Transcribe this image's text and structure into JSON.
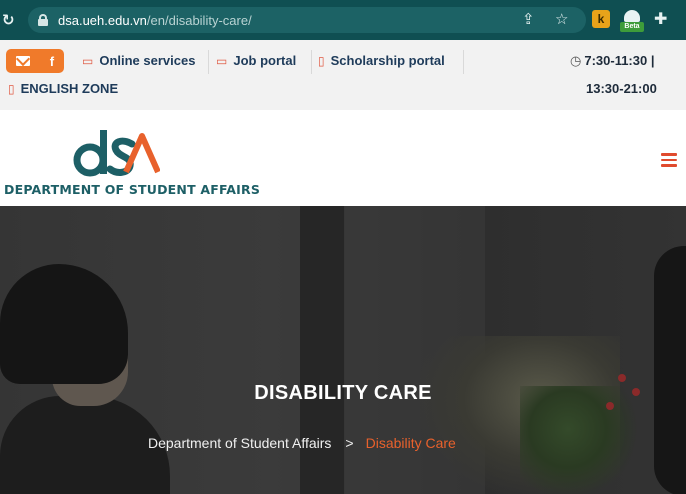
{
  "browser": {
    "url_host": "dsa.ueh.edu.vn",
    "url_path": "/en/disability-care/",
    "ext_k_label": "k",
    "ext_beta_label": "Beta"
  },
  "topbar": {
    "social": [
      "mail",
      "f"
    ],
    "links": {
      "online": "Online services",
      "job": "Job portal",
      "scholarship": "Scholarship portal",
      "english": "ENGLISH ZONE"
    },
    "hours_line1": "7:30-11:30 |",
    "hours_line2": "13:30-21:00"
  },
  "header": {
    "department_name": "DEPARTMENT OF STUDENT AFFAIRS",
    "logo_alt": "dSA"
  },
  "hero": {
    "title": "DISABILITY CARE",
    "breadcrumb_home": "Department of Student Affairs",
    "breadcrumb_sep": ">",
    "breadcrumb_current": "Disability Care"
  },
  "colors": {
    "browser_bg": "#0f4f52",
    "accent": "#f07a2a",
    "brand_teal": "#1d5f66",
    "menu_red": "#e04b2e",
    "breadcrumb_current": "#e8612c"
  }
}
